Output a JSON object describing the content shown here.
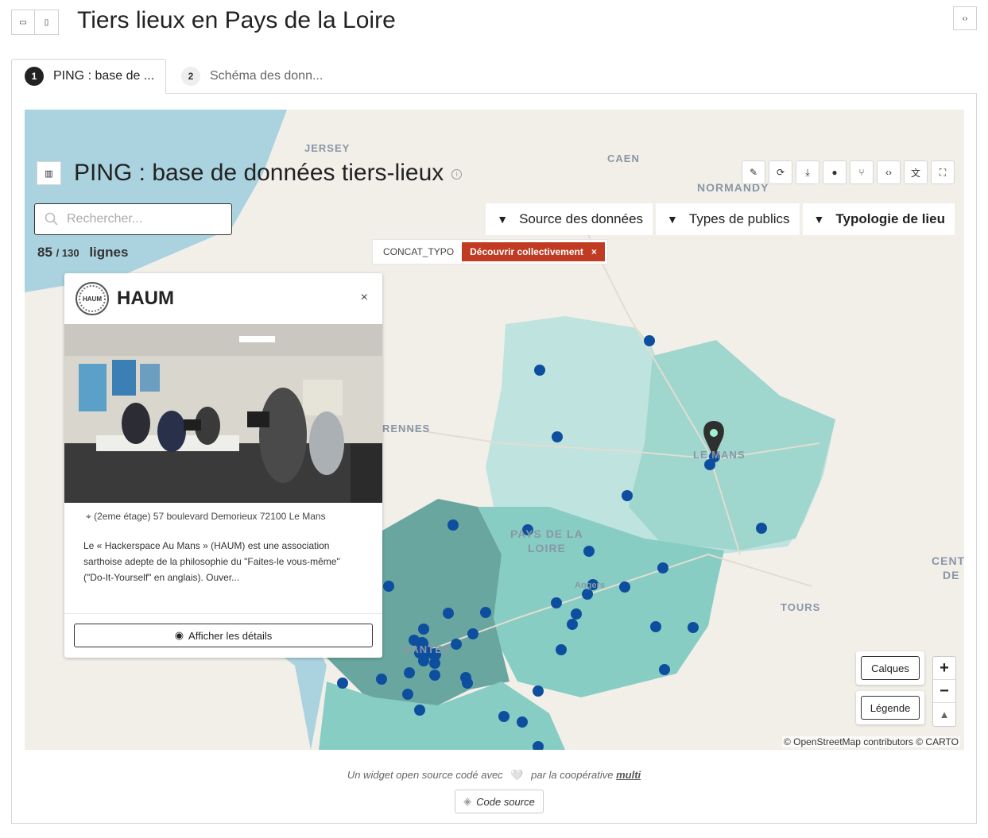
{
  "page": {
    "title": "Tiers lieux en Pays de la Loire",
    "top_left_icons": [
      "layout-horizontal-icon",
      "layout-vertical-icon"
    ],
    "embed_icon": "code-icon"
  },
  "tabs": [
    {
      "number": "1",
      "label": "PING : base de ...",
      "active": true
    },
    {
      "number": "2",
      "label": "Schéma des donn...",
      "active": false
    }
  ],
  "map": {
    "title": "PING : base de données tiers-lieux",
    "toolbar_icons": [
      "pencil-icon",
      "reload-icon",
      "download-icon",
      "user-icon",
      "branch-icon",
      "code-icon",
      "translate-icon",
      "fullscreen-icon"
    ],
    "search_placeholder": "Rechercher...",
    "count": {
      "shown": "85",
      "total": "/ 130",
      "unit": "lignes"
    },
    "filters": [
      {
        "label": "Source des données",
        "bold": false
      },
      {
        "label": "Types de publics",
        "bold": false
      },
      {
        "label": "Typologie de lieu",
        "bold": true
      }
    ],
    "active_filter": {
      "key": "CONCAT_TYPO",
      "value": "Découvrir collectivement",
      "remove": "×"
    },
    "place_labels": [
      "JERSEY",
      "CAEN",
      "NORMANDY",
      "RENNES",
      "LE MANS",
      "PAYS DE LA",
      "LOIRE",
      "Angers",
      "NANTES",
      "TOURS",
      "CENT",
      "DE"
    ],
    "layers_button": "Calques",
    "legend_button": "Légende",
    "zoom": {
      "in": "+",
      "out": "−",
      "reset": "▲"
    },
    "attribution": "© OpenStreetMap contributors © CARTO",
    "colors": {
      "sea": "#aad3df",
      "land": "#f2efe9",
      "region_light": "#bfe3de",
      "region_mid": "#87cdc3",
      "region_dark": "#6aa6a0",
      "marker": "#0d4f9e"
    }
  },
  "popup": {
    "logo_text": "HAUM",
    "name": "HAUM",
    "close": "×",
    "address": "(2eme étage) 57 boulevard Demorieux 72100 Le Mans",
    "description": "Le « Hackerspace Au Mans » (HAUM) est une association sarthoise adepte de la philosophie du \"Faites-le vous-même\" (\"Do-It-Yourself\" en anglais). Ouver...",
    "details_button": "Afficher les détails"
  },
  "footer": {
    "text_prefix": "Un widget open source codé avec",
    "heart": "🤍",
    "text_middle": "par la coopérative",
    "coop": "multi",
    "code_button": "Code source"
  }
}
